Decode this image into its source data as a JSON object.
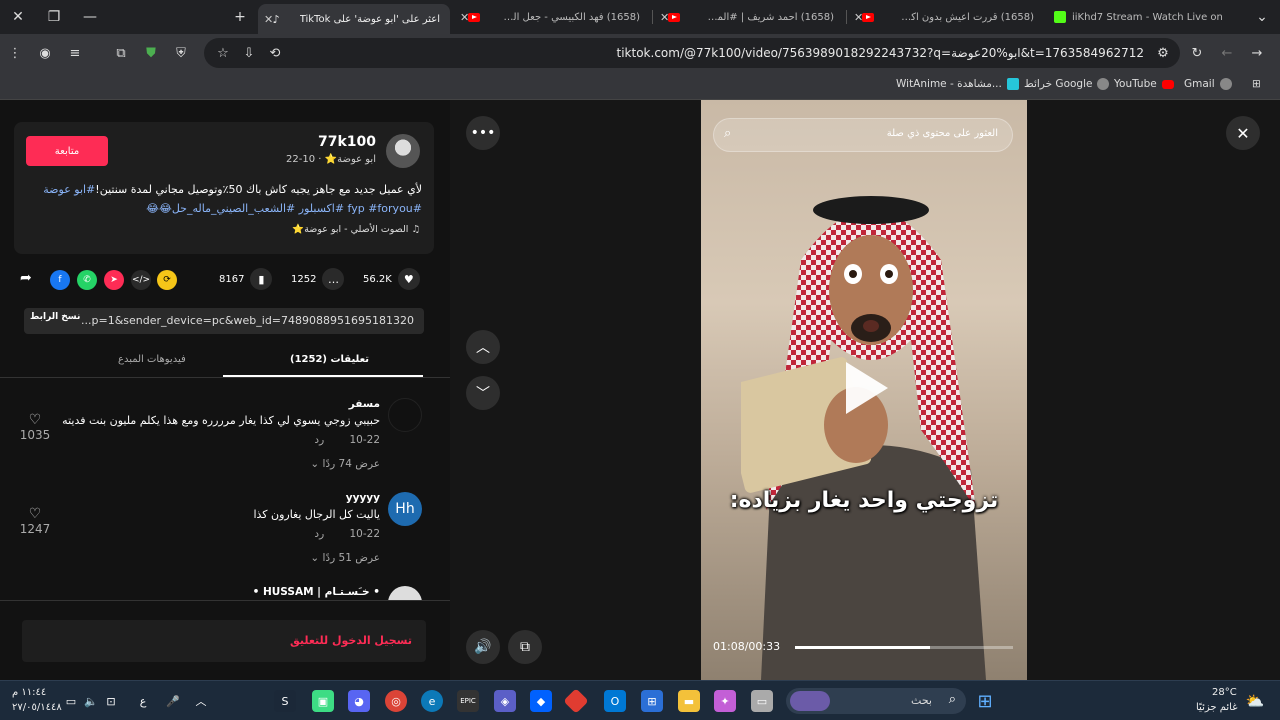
{
  "browser": {
    "tabs": [
      {
        "title": "iiKhd7 Stream - Watch Live on",
        "favicon": "kick"
      },
      {
        "title": "(1658) قررت اعيش بدون اكل لمدة",
        "favicon": "youtube"
      },
      {
        "title": "(1658) احمد شريف | #المساح |",
        "favicon": "youtube"
      },
      {
        "title": "(1658) فهد الكبيسي - جعل السحاب",
        "favicon": "youtube"
      },
      {
        "title": "اعثر على 'ابو عوضة' على TikTok",
        "favicon": "tiktok",
        "active": true
      }
    ],
    "url": "tiktok.com/@77k100/video/7563989018292243732?q=ابو%20عوضة&t=1763584962712",
    "bookmarks": [
      {
        "label": "Gmail",
        "icon": "globe-icon"
      },
      {
        "label": "YouTube",
        "icon": "youtube-icon"
      },
      {
        "label": "خرائط Google",
        "icon": "globe-icon"
      },
      {
        "label": "WitAnime - مشاهدة...",
        "icon": "witanime-icon"
      }
    ]
  },
  "post": {
    "username": "77k100",
    "display": "ابو عوضة⭐ · 10-22",
    "follow_label": "متابعة",
    "caption_text": "لأي عميل جديد مع جاهز يجيه كاش باك 50٪وتوصيل مجاني لمدة سنتين!",
    "caption_tags_1": "#ابو عوضة",
    "caption_tags_2": "#fyp #foryou #اكسبلور #الشعب_الصيني_ماله_حل😂😂",
    "sound": "♫ الصوت الأصلي - ابو عوضة⭐",
    "likes": "56.2K",
    "comments_count": "1252",
    "saves": "8167",
    "link": "...p=1&sender_device=pc&web_id=7489088951695181320",
    "copy_link_label": "نسخ الرابط",
    "tab_comments": "تعليقات (1252)",
    "tab_creator": "فيديوهات المبدع",
    "login_prompt": "تسجيل الدخول للتعليق"
  },
  "comments": [
    {
      "name": "مسفر",
      "text": "حبيبي زوجي يسوي لي كذا يغار مرررره ومع هذا يكلم مليون بنت فديته",
      "date": "10-22",
      "reply": "رد",
      "replies": "عرض 74 ردًا",
      "likes": "1035"
    },
    {
      "name": "yyyyy",
      "text": "ياليت كل الرجال يغارون كذا",
      "date": "10-22",
      "reply": "رد",
      "replies": "عرض 51 ردًا",
      "likes": "1247",
      "avatar_text": "Hh"
    },
    {
      "name": "• خـَسـتـام | HUSSAM •",
      "text": "",
      "date": "",
      "reply": "",
      "replies": "",
      "likes": ""
    }
  ],
  "video": {
    "search_placeholder": "العثور على محتوى ذي صلة",
    "subtitle": "تزوجتي واحد يغار بزياده:",
    "time": "01:08/00:33",
    "progress": 0.62
  },
  "taskbar": {
    "weather_temp": "28°C",
    "weather_text": "غائم جزئيًا",
    "search_text": "بحث",
    "time": "١١:٤٤ م",
    "date": "٢٧/٠٥/١٤٤٨",
    "lang": "ع"
  },
  "colors": {
    "accent": "#fe2c55",
    "link": "#8ab4f8",
    "taskbar": "#1c2a3a"
  }
}
